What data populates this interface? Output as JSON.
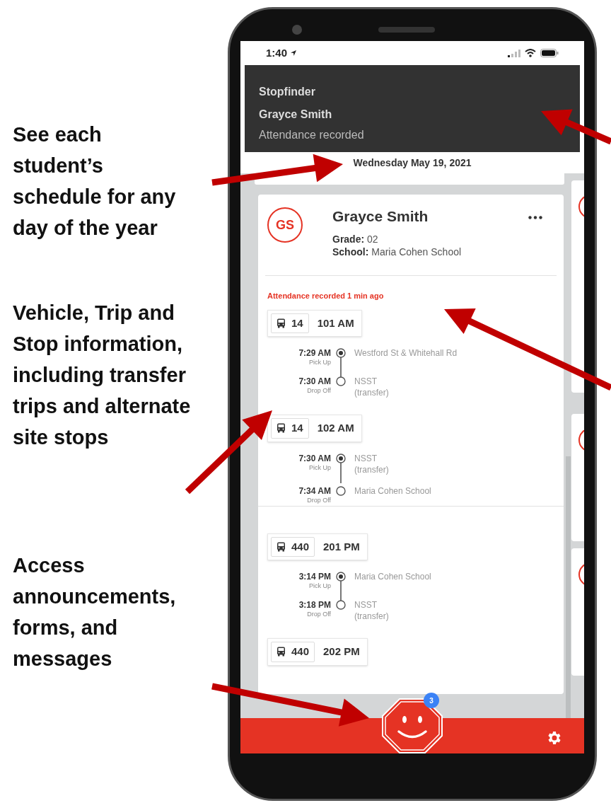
{
  "annotations": [
    {
      "text": "See each student’s schedule for any day of the year"
    },
    {
      "text": "Vehicle, Trip and Stop information, including transfer trips and alternate site stops"
    },
    {
      "text": "Access announcements, forms, and messages"
    }
  ],
  "phone": {
    "status_bar": {
      "time": "1:40"
    },
    "notification": {
      "app": "Stopfinder",
      "title": "Grayce Smith",
      "message": "Attendance recorded"
    },
    "date": "Wednesday May 19, 2021",
    "student": {
      "initials": "GS",
      "name": "Grayce Smith",
      "grade_label": "Grade:",
      "grade": "02",
      "school_label": "School:",
      "school": "Maria Cohen School",
      "status": "Attendance recorded 1 min ago"
    },
    "segments": [
      {
        "trips": [
          {
            "bus": "14",
            "trip": "101 AM",
            "stops": [
              {
                "kind": "pickup",
                "time": "7:29 AM",
                "action": "Pick Up",
                "place": "Westford St & Whitehall Rd"
              },
              {
                "kind": "dropoff",
                "time": "7:30 AM",
                "action": "Drop Off",
                "place": "NSST",
                "note": "(transfer)"
              }
            ]
          },
          {
            "bus": "14",
            "trip": "102 AM",
            "stops": [
              {
                "kind": "pickup",
                "time": "7:30 AM",
                "action": "Pick Up",
                "place": "NSST",
                "note": "(transfer)"
              },
              {
                "kind": "dropoff",
                "time": "7:34 AM",
                "action": "Drop Off",
                "place": "Maria Cohen School"
              }
            ]
          }
        ]
      },
      {
        "trips": [
          {
            "bus": "440",
            "trip": "201 PM",
            "stops": [
              {
                "kind": "pickup",
                "time": "3:14 PM",
                "action": "Pick Up",
                "place": "Maria Cohen School"
              },
              {
                "kind": "dropoff",
                "time": "3:18 PM",
                "action": "Drop Off",
                "place": "NSST",
                "note": "(transfer)"
              }
            ]
          },
          {
            "bus": "440",
            "trip": "202 PM"
          }
        ]
      }
    ],
    "messages_badge": "3"
  }
}
